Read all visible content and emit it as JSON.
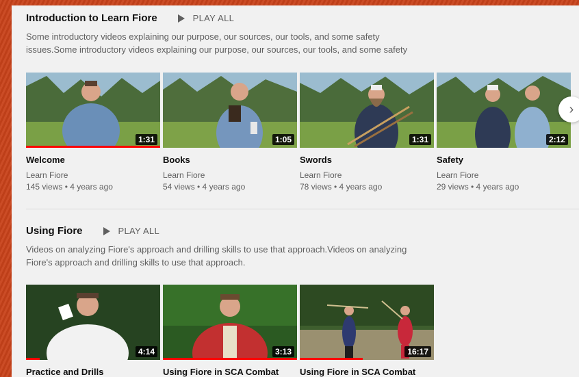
{
  "shelves": [
    {
      "title": "Introduction to Learn Fiore",
      "play_all": "PLAY ALL",
      "description": "Some introductory videos explaining our purpose, our sources, our tools, and some safety issues.Some introductory videos explaining our purpose, our sources, our tools, and some safety",
      "videos": [
        {
          "title": "Welcome",
          "channel": "Learn Fiore",
          "meta": "145 views • 4 years ago",
          "duration": "1:31",
          "watched_fraction": 1.0
        },
        {
          "title": "Books",
          "channel": "Learn Fiore",
          "meta": "54 views • 4 years ago",
          "duration": "1:05",
          "watched_fraction": 0
        },
        {
          "title": "Swords",
          "channel": "Learn Fiore",
          "meta": "78 views • 4 years ago",
          "duration": "1:31",
          "watched_fraction": 0
        },
        {
          "title": "Safety",
          "channel": "Learn Fiore",
          "meta": "29 views • 4 years ago",
          "duration": "2:12",
          "watched_fraction": 0
        }
      ]
    },
    {
      "title": "Using Fiore",
      "play_all": "PLAY ALL",
      "description": "Videos on analyzing Fiore's approach and drilling skills to use that approach.Videos on analyzing Fiore's approach and drilling skills to use that approach.",
      "videos": [
        {
          "title": "Practice and Drills",
          "duration": "4:14",
          "watched_fraction": 0.1
        },
        {
          "title": "Using Fiore in SCA Combat",
          "duration": "3:13",
          "watched_fraction": 1.0
        },
        {
          "title": "Using Fiore in SCA Combat",
          "duration": "16:17",
          "watched_fraction": 0.47
        }
      ]
    }
  ],
  "icons": {
    "play_all": "play-icon",
    "next": "chevron-right-icon"
  }
}
